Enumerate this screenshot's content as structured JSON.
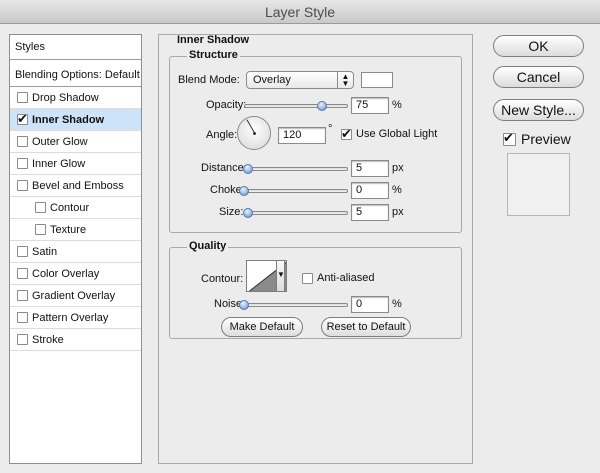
{
  "window": {
    "title": "Layer Style"
  },
  "styles_list": {
    "header": "Styles",
    "blending_options": "Blending Options: Default",
    "items": [
      {
        "label": "Drop Shadow",
        "checked": false,
        "selected": false,
        "indent": false
      },
      {
        "label": "Inner Shadow",
        "checked": true,
        "selected": true,
        "indent": false
      },
      {
        "label": "Outer Glow",
        "checked": false,
        "selected": false,
        "indent": false
      },
      {
        "label": "Inner Glow",
        "checked": false,
        "selected": false,
        "indent": false
      },
      {
        "label": "Bevel and Emboss",
        "checked": false,
        "selected": false,
        "indent": false
      },
      {
        "label": "Contour",
        "checked": false,
        "selected": false,
        "indent": true
      },
      {
        "label": "Texture",
        "checked": false,
        "selected": false,
        "indent": true
      },
      {
        "label": "Satin",
        "checked": false,
        "selected": false,
        "indent": false
      },
      {
        "label": "Color Overlay",
        "checked": false,
        "selected": false,
        "indent": false
      },
      {
        "label": "Gradient Overlay",
        "checked": false,
        "selected": false,
        "indent": false
      },
      {
        "label": "Pattern Overlay",
        "checked": false,
        "selected": false,
        "indent": false
      },
      {
        "label": "Stroke",
        "checked": false,
        "selected": false,
        "indent": false
      }
    ]
  },
  "panel": {
    "title": "Inner Shadow",
    "structure": {
      "title": "Structure",
      "blend_mode_label": "Blend Mode:",
      "blend_mode_value": "Overlay",
      "opacity_label": "Opacity:",
      "opacity_value": "75",
      "opacity_unit": "%",
      "angle_label": "Angle:",
      "angle_value": "120",
      "angle_unit": "°",
      "use_global_light_label": "Use Global Light",
      "use_global_light_checked": true,
      "distance_label": "Distance:",
      "distance_value": "5",
      "distance_unit": "px",
      "choke_label": "Choke:",
      "choke_value": "0",
      "choke_unit": "%",
      "size_label": "Size:",
      "size_value": "5",
      "size_unit": "px"
    },
    "quality": {
      "title": "Quality",
      "contour_label": "Contour:",
      "anti_aliased_label": "Anti-aliased",
      "anti_aliased_checked": false,
      "noise_label": "Noise:",
      "noise_value": "0",
      "noise_unit": "%"
    },
    "make_default_label": "Make Default",
    "reset_default_label": "Reset to Default"
  },
  "actions": {
    "ok_label": "OK",
    "cancel_label": "Cancel",
    "new_style_label": "New Style...",
    "preview_label": "Preview",
    "preview_checked": true
  },
  "icons": {
    "checkmark": "checkmark-icon",
    "select_arrows": "updown-arrows-icon",
    "contour_curve": "contour-curve-icon",
    "dropdown": "dropdown-triangle-icon"
  },
  "colors": {
    "selection": "#cde3f8",
    "slider_thumb": "#5a8fd3"
  }
}
